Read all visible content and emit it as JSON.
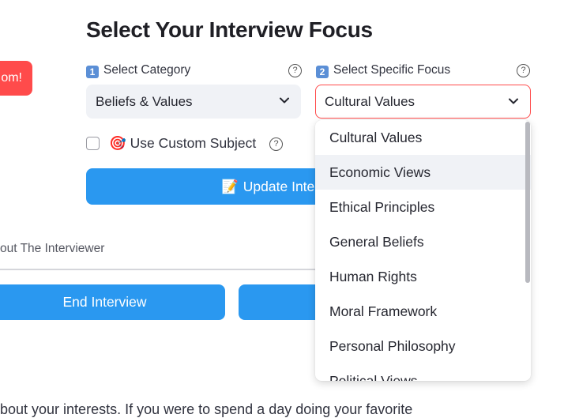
{
  "alert_pill": {
    "text": "om!"
  },
  "heading": "Select Your Interview Focus",
  "category": {
    "number": "1",
    "label": "Select Category",
    "value": "Beliefs & Values"
  },
  "focus": {
    "number": "2",
    "label": "Select Specific Focus",
    "value": "Cultural Values",
    "options": [
      "Cultural Values",
      "Economic Views",
      "Ethical Principles",
      "General Beliefs",
      "Human Rights",
      "Moral Framework",
      "Personal Philosophy",
      "Political Views"
    ],
    "highlighted_option": "Economic Views"
  },
  "custom_subject": {
    "icon": "🎯",
    "label": "Use Custom Subject",
    "checked": false
  },
  "update_button": {
    "icon": "📝",
    "label": "Update Inte"
  },
  "about_label": "out The Interviewer",
  "end_button": {
    "label": "End Interview"
  },
  "transcript_snippet": "bout your interests. If you were to spend a day doing your favorite",
  "colors": {
    "primary": "#2a98f0",
    "danger": "#ff4b4b",
    "select_bg": "#f0f2f6"
  }
}
